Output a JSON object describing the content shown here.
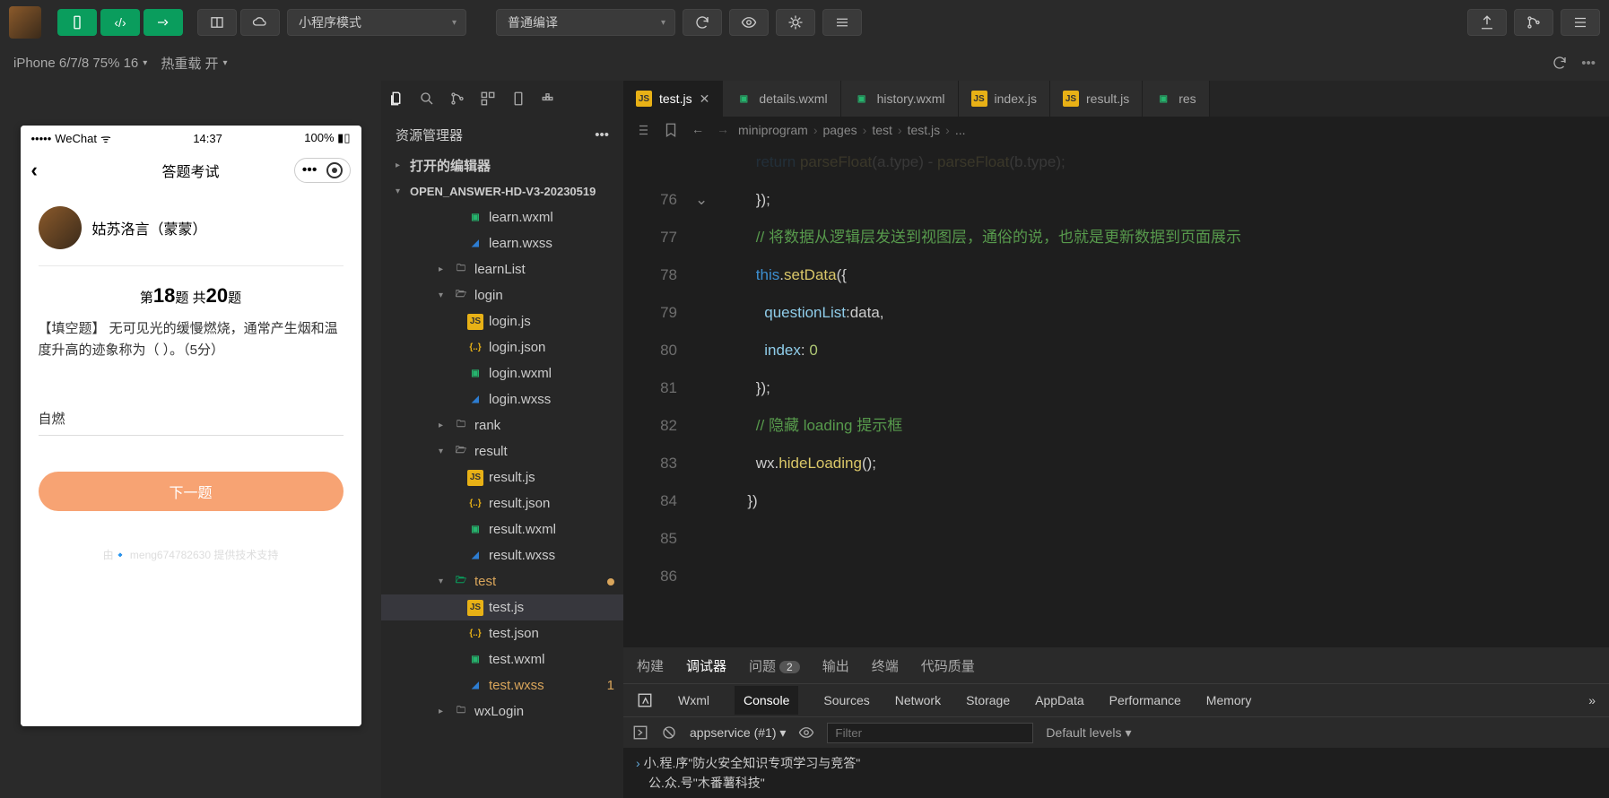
{
  "toolbar": {
    "mode_select": "小程序模式",
    "compile_select": "普通编译"
  },
  "simulator_bar": {
    "device": "iPhone 6/7/8 75% 16",
    "reload": "热重载 开"
  },
  "phone": {
    "carrier": "WeChat",
    "time": "14:37",
    "battery": "100%",
    "nav_title": "答题考试",
    "user_name": "姑苏洛言（蒙蒙）",
    "progress_prefix": "第",
    "progress_num": "18",
    "progress_mid": "题 共",
    "progress_total": "20",
    "progress_suffix": "题",
    "question": "【填空题】 无可见光的缓慢燃烧，通常产生烟和温度升高的迹象称为（ ）。（5分）",
    "answer": "自燃",
    "next_btn": "下一题",
    "tech": "由🔹 meng674782630 提供技术支持"
  },
  "explorer": {
    "title": "资源管理器",
    "sections": {
      "opened": "打开的编辑器",
      "project": "OPEN_ANSWER-HD-V3-20230519"
    },
    "tree": [
      {
        "name": "learn.wxml",
        "icon": "wxml",
        "indent": 4
      },
      {
        "name": "learn.wxss",
        "icon": "wxss",
        "indent": 4
      },
      {
        "name": "learnList",
        "icon": "folder",
        "indent": 3,
        "arrow": "▸"
      },
      {
        "name": "login",
        "icon": "folder-open",
        "indent": 3,
        "arrow": "▾"
      },
      {
        "name": "login.js",
        "icon": "js",
        "indent": 4
      },
      {
        "name": "login.json",
        "icon": "json",
        "indent": 4
      },
      {
        "name": "login.wxml",
        "icon": "wxml",
        "indent": 4
      },
      {
        "name": "login.wxss",
        "icon": "wxss",
        "indent": 4
      },
      {
        "name": "rank",
        "icon": "folder",
        "indent": 3,
        "arrow": "▸"
      },
      {
        "name": "result",
        "icon": "folder-open",
        "indent": 3,
        "arrow": "▾"
      },
      {
        "name": "result.js",
        "icon": "js",
        "indent": 4
      },
      {
        "name": "result.json",
        "icon": "json",
        "indent": 4
      },
      {
        "name": "result.wxml",
        "icon": "wxml",
        "indent": 4
      },
      {
        "name": "result.wxss",
        "icon": "wxss",
        "indent": 4
      },
      {
        "name": "test",
        "icon": "folder-test",
        "indent": 3,
        "arrow": "▾",
        "modified": true
      },
      {
        "name": "test.js",
        "icon": "js",
        "indent": 4,
        "selected": true
      },
      {
        "name": "test.json",
        "icon": "json",
        "indent": 4
      },
      {
        "name": "test.wxml",
        "icon": "wxml",
        "indent": 4
      },
      {
        "name": "test.wxss",
        "icon": "wxss",
        "indent": 4,
        "modified": true,
        "badge": "1"
      },
      {
        "name": "wxLogin",
        "icon": "folder",
        "indent": 3,
        "arrow": "▸"
      }
    ]
  },
  "tabs": [
    {
      "label": "test.js",
      "icon": "js",
      "active": true,
      "close": true
    },
    {
      "label": "details.wxml",
      "icon": "wxml"
    },
    {
      "label": "history.wxml",
      "icon": "wxml"
    },
    {
      "label": "index.js",
      "icon": "js"
    },
    {
      "label": "result.js",
      "icon": "js"
    },
    {
      "label": "res",
      "icon": "wxml",
      "trunc": true
    }
  ],
  "breadcrumb": [
    "miniprogram",
    "pages",
    "test",
    "test.js",
    "..."
  ],
  "code": {
    "lines": [
      {
        "n": 76,
        "html": "        });"
      },
      {
        "n": 77,
        "html": ""
      },
      {
        "n": 78,
        "html": "        <span class='tok-cmt'>// 将数据从逻辑层发送到视图层，通俗的说，也就是更新数据到页面展示</span>"
      },
      {
        "n": 79,
        "html": "        <span class='tok-this'>this</span>.<span class='tok-fn'>setData</span>({",
        "fold": true
      },
      {
        "n": 80,
        "html": "          <span class='tok-prop'>questionList</span>:data,"
      },
      {
        "n": 81,
        "html": "          <span class='tok-prop'>index</span>: <span class='tok-num'>0</span>"
      },
      {
        "n": 82,
        "html": "        });"
      },
      {
        "n": 83,
        "html": ""
      },
      {
        "n": 84,
        "html": "        <span class='tok-cmt'>// 隐藏 loading 提示框</span>"
      },
      {
        "n": 85,
        "html": "        wx.<span class='tok-fn'>hideLoading</span>();"
      },
      {
        "n": 86,
        "html": "      })"
      }
    ],
    "top_partial": "        <span class='tok-kw'>return</span> <span class='tok-fn'>parseFloat</span>(a.type) - <span class='tok-fn'>parseFloat</span>(b.type);"
  },
  "devtools": {
    "tabs": [
      "构建",
      "调试器",
      "问题",
      "输出",
      "终端",
      "代码质量"
    ],
    "active": "调试器",
    "problems_count": "2",
    "sub": [
      "Wxml",
      "Console",
      "Sources",
      "Network",
      "Storage",
      "AppData",
      "Performance",
      "Memory"
    ],
    "sub_active": "Console",
    "context": "appservice (#1)",
    "filter_ph": "Filter",
    "levels": "Default levels",
    "console_lines": [
      "小.程.序\"防火安全知识专项学习与竞答\"",
      "公.众.号\"木番薯科技\""
    ]
  }
}
